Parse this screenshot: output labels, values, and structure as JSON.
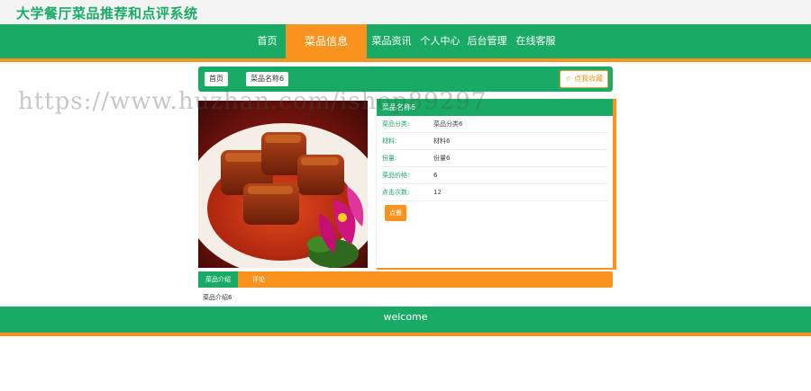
{
  "site": {
    "title": "大学餐厅菜品推荐和点评系统"
  },
  "nav": {
    "items": [
      "首页",
      "菜品信息",
      "菜品资讯",
      "个人中心",
      "后台管理",
      "在线客服"
    ],
    "active": "菜品信息"
  },
  "watermark": "https://www.huzhan.com/ishop89297",
  "breadcrumb": {
    "home": "首页",
    "current": "菜品名称6"
  },
  "favorite": {
    "label": "☆ 点我收藏"
  },
  "info": {
    "header": "菜品名称6",
    "rows": [
      {
        "label": "菜品分类:",
        "value": "菜品分类6"
      },
      {
        "label": "材料:",
        "value": "材料6"
      },
      {
        "label": "份量:",
        "value": "份量6"
      },
      {
        "label": "菜品价格:",
        "value": "6"
      },
      {
        "label": "点击次数:",
        "value": "12"
      }
    ],
    "order_label": "点餐"
  },
  "tabs": {
    "items": [
      "菜品介绍",
      "评论"
    ],
    "active": "菜品介绍"
  },
  "intro": "菜品介绍6",
  "footer": {
    "text": "welcome"
  },
  "colors": {
    "primary": "#19ab66",
    "accent": "#f7931e"
  }
}
